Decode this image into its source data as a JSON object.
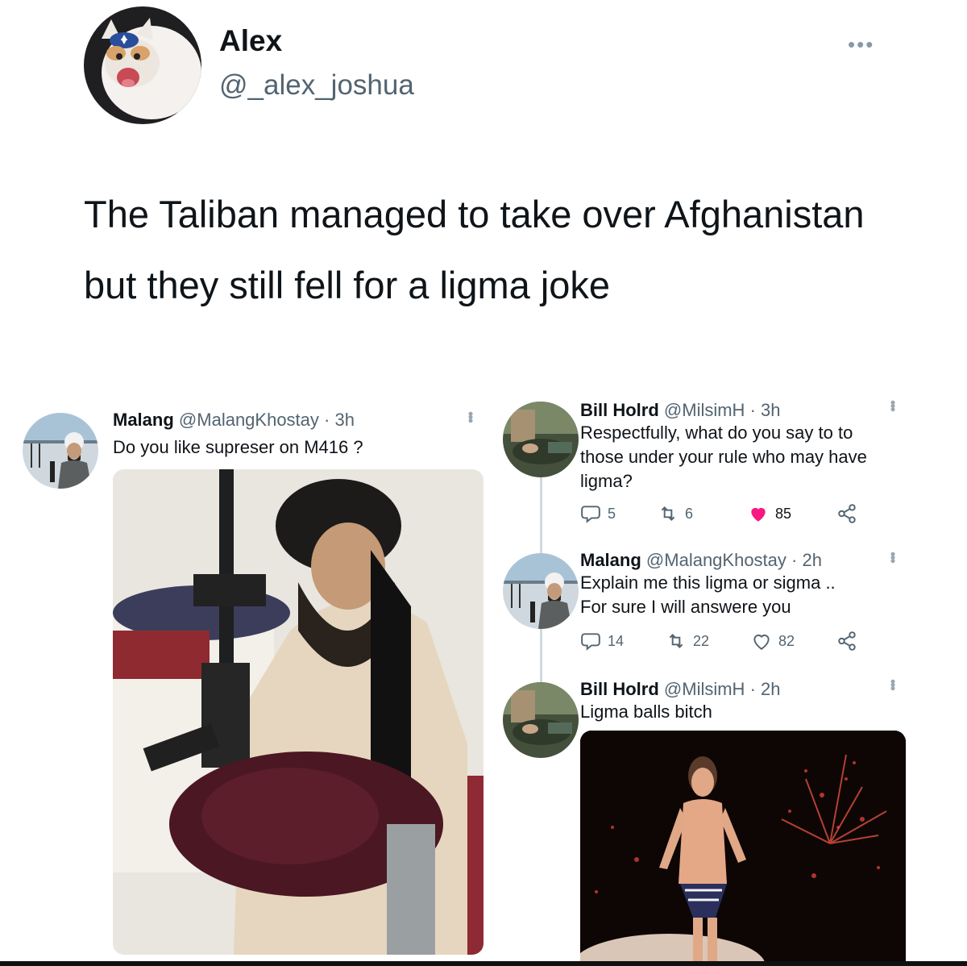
{
  "main_tweet": {
    "author_name": "Alex",
    "author_handle": "@_alex_joshua",
    "more_label": "•••",
    "text": "The Taliban managed to take over Afghanistan but they still fell for a ligma joke"
  },
  "quoted_tweet": {
    "author_name": "Malang",
    "author_handle": "@MalangKhostay",
    "time": "· 3h",
    "text": "Do you like supreser on M416 ?"
  },
  "replies": [
    {
      "author_name": "Bill Holrd",
      "author_handle": "@MilsimH",
      "time": "· 3h",
      "text": "Respectfully, what do you say to to those under your rule who may have ligma?",
      "replies_count": "5",
      "retweets_count": "6",
      "likes_count": "85",
      "liked": true
    },
    {
      "author_name": "Malang",
      "author_handle": "@MalangKhostay",
      "time": "· 2h",
      "text": "Explain me this ligma or sigma .. For sure I will answere you",
      "replies_count": "14",
      "retweets_count": "22",
      "likes_count": "82",
      "liked": false
    },
    {
      "author_name": "Bill Holrd",
      "author_handle": "@MilsimH",
      "time": "· 2h",
      "text": "Ligma balls bitch"
    }
  ],
  "colors": {
    "text": "#0f1419",
    "secondary": "#536471",
    "like_red": "#f91880",
    "thread_line": "#cfd9de"
  },
  "icons": [
    "reply-icon",
    "retweet-icon",
    "heart-icon",
    "share-icon",
    "more-icon"
  ]
}
